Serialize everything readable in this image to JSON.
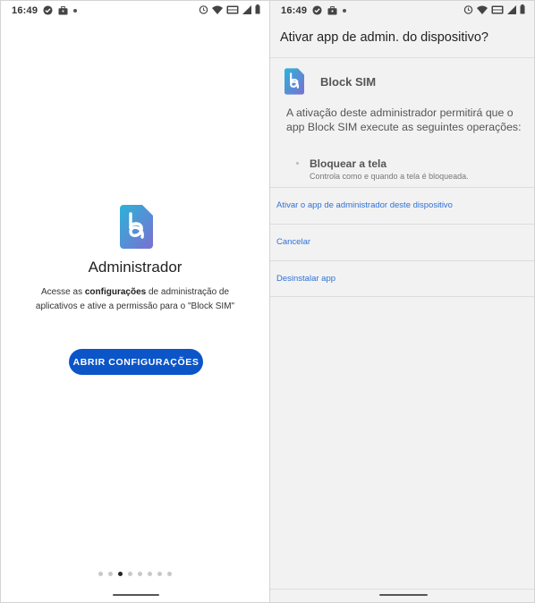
{
  "left": {
    "status_time": "16:49",
    "title": "Administrador",
    "desc_prefix": "Acesse as ",
    "desc_bold": "configurações",
    "desc_suffix": " de administração de aplicativos e ative a permissão para o \"Block SIM\"",
    "button_label": "ABRIR CONFIGURAÇÕES",
    "pager_active_index": 2,
    "pager_count": 8
  },
  "right": {
    "status_time": "16:49",
    "dialog_title": "Ativar app de admin. do dispositivo?",
    "app_name": "Block SIM",
    "permission_intro": "A ativação deste administrador permitirá que o app Block SIM execute as seguintes operações:",
    "policy_title": "Bloquear a tela",
    "policy_desc": "Controla como e quando a tela é bloqueada.",
    "actions": {
      "activate": "Ativar o app de administrador deste dispositivo",
      "cancel": "Cancelar",
      "uninstall": "Desinstalar app"
    }
  },
  "colors": {
    "primary_button": "#0b55c8",
    "link": "#2f72d6",
    "logo_gradient_start": "#2bb3d9",
    "logo_gradient_end": "#7b6fd1"
  },
  "icons": [
    "alarm-icon",
    "wifi-icon",
    "volte-icon",
    "signal-icon",
    "battery-icon",
    "check-circle-icon",
    "briefcase-icon"
  ]
}
